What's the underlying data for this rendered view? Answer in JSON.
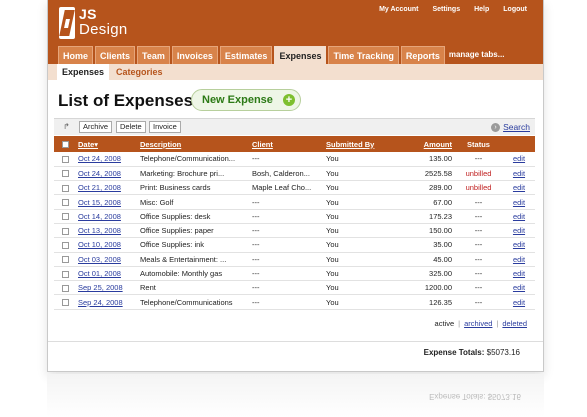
{
  "brand": {
    "line1": "JS",
    "line2": "Design"
  },
  "toplinks": [
    "My Account",
    "Settings",
    "Help",
    "Logout"
  ],
  "tabs": [
    "Home",
    "Clients",
    "Team",
    "Invoices",
    "Estimates",
    "Expenses",
    "Time Tracking",
    "Reports"
  ],
  "active_tab": "Expenses",
  "manage_tabs": "manage tabs...",
  "subnav": {
    "expenses": "Expenses",
    "categories": "Categories"
  },
  "page_title": "List of Expenses",
  "new_expense_label": "New Expense",
  "toolbar": {
    "archive": "Archive",
    "delete": "Delete",
    "invoice": "Invoice",
    "search": "Search"
  },
  "columns": {
    "date": "Date▾",
    "description": "Description",
    "client": "Client",
    "submitted_by": "Submitted By",
    "amount": "Amount",
    "status": "Status"
  },
  "rows": [
    {
      "date": "Oct 24, 2008",
      "description": "Telephone/Communication...",
      "client": "---",
      "submitted_by": "You",
      "amount": "135.00",
      "status": "---",
      "edit": "edit"
    },
    {
      "date": "Oct 24, 2008",
      "description": "Marketing: Brochure pri...",
      "client": "Bosh, Calderon...",
      "submitted_by": "You",
      "amount": "2525.58",
      "status": "unbilled",
      "edit": "edit"
    },
    {
      "date": "Oct 21, 2008",
      "description": "Print: Business cards",
      "client": "Maple Leaf Cho...",
      "submitted_by": "You",
      "amount": "289.00",
      "status": "unbilled",
      "edit": "edit"
    },
    {
      "date": "Oct 15, 2008",
      "description": "Misc: Golf",
      "client": "---",
      "submitted_by": "You",
      "amount": "67.00",
      "status": "---",
      "edit": "edit"
    },
    {
      "date": "Oct 14, 2008",
      "description": "Office Supplies: desk",
      "client": "---",
      "submitted_by": "You",
      "amount": "175.23",
      "status": "---",
      "edit": "edit"
    },
    {
      "date": "Oct 13, 2008",
      "description": "Office Supplies: paper",
      "client": "---",
      "submitted_by": "You",
      "amount": "150.00",
      "status": "---",
      "edit": "edit"
    },
    {
      "date": "Oct 10, 2008",
      "description": "Office Supplies: ink",
      "client": "---",
      "submitted_by": "You",
      "amount": "35.00",
      "status": "---",
      "edit": "edit"
    },
    {
      "date": "Oct 03, 2008",
      "description": "Meals & Entertainment: ...",
      "client": "---",
      "submitted_by": "You",
      "amount": "45.00",
      "status": "---",
      "edit": "edit"
    },
    {
      "date": "Oct 01, 2008",
      "description": "Automobile: Monthly gas",
      "client": "---",
      "submitted_by": "You",
      "amount": "325.00",
      "status": "---",
      "edit": "edit"
    },
    {
      "date": "Sep 25, 2008",
      "description": "Rent",
      "client": "---",
      "submitted_by": "You",
      "amount": "1200.00",
      "status": "---",
      "edit": "edit"
    },
    {
      "date": "Sep 24, 2008",
      "description": "Telephone/Communications",
      "client": "---",
      "submitted_by": "You",
      "amount": "126.35",
      "status": "---",
      "edit": "edit"
    }
  ],
  "filters": {
    "active": "active",
    "archived": "archived",
    "deleted": "deleted"
  },
  "totals": {
    "label": "Expense Totals:",
    "value": "$5073.16"
  },
  "colors": {
    "brand": "#b6541c",
    "tab_active_bg": "#f3dfcf",
    "link": "#2a3c9e",
    "unbilled": "#c02020",
    "new_expense_green": "#2c7a16"
  },
  "icons": {
    "logo": "js-design-logo",
    "new_expense": "plus-circle-icon",
    "search": "search-icon",
    "corner": "corner-arrow-icon"
  }
}
